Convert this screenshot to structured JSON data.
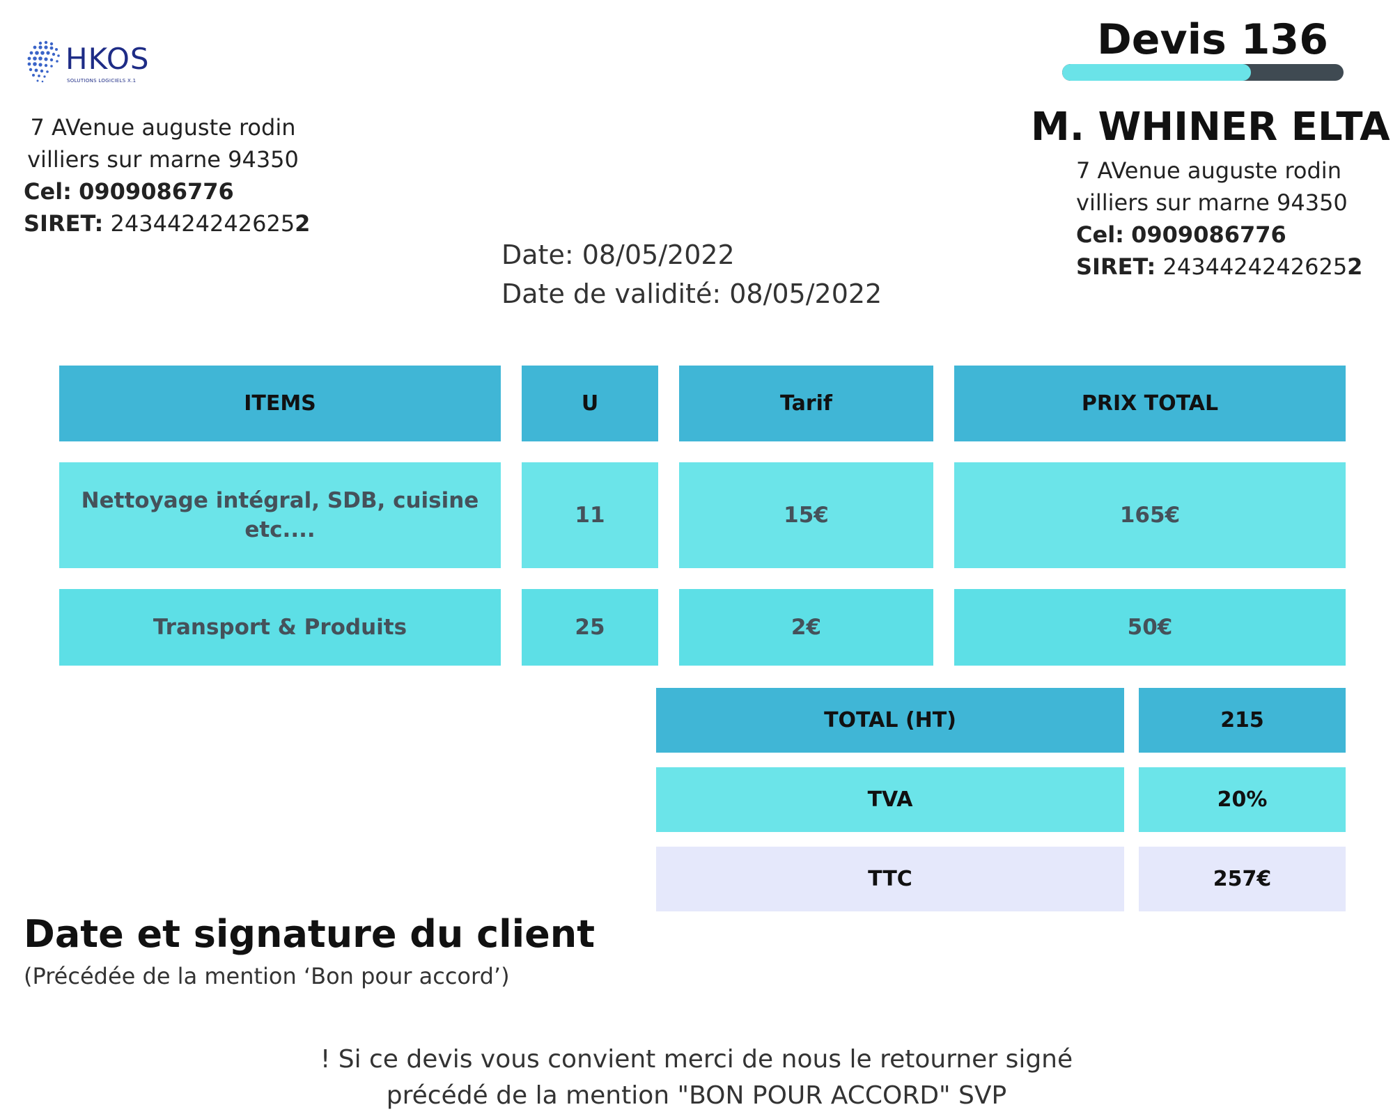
{
  "logo": {
    "brand": "HKOS",
    "tagline": "SOLUTIONS LOGICIELS X.1",
    "color": "#1e2c86"
  },
  "sender": {
    "street": "7 AVenue auguste rodin",
    "city": "villiers sur marne 94350",
    "cel_label": "Cel:",
    "cel_value": "0909086776",
    "siret_label": "SIRET:",
    "siret_value": "2434424242625",
    "siret_last": "2"
  },
  "quote": {
    "title": "Devis 136",
    "progress_fraction": 0.67
  },
  "client": {
    "name": "M. WHINER ELTA",
    "street": "7 AVenue auguste rodin",
    "city": "villiers sur marne 94350",
    "cel_label": "Cel:",
    "cel_value": "0909086776",
    "siret_label": "SIRET:",
    "siret_value": "2434424242625",
    "siret_last": "2"
  },
  "dates": {
    "date": "Date: 08/05/2022",
    "validity": "Date de validité: 08/05/2022"
  },
  "table": {
    "headers": [
      "ITEMS",
      "U",
      "Tarif",
      "PRIX TOTAL"
    ],
    "rows": [
      [
        "Nettoyage intégral, SDB, cuisine etc....",
        "11",
        "15€",
        "165€"
      ],
      [
        "Transport & Produits",
        "25",
        "2€",
        "50€"
      ]
    ]
  },
  "totals": {
    "ht_label": "TOTAL (HT)",
    "ht_value": "215",
    "tva_label": "TVA",
    "tva_value": "20%",
    "ttc_label": "TTC",
    "ttc_value": "257€"
  },
  "signature": {
    "title": "Date et signature du client",
    "subtitle": "(Précédée de la mention ‘Bon pour accord’)"
  },
  "footer": {
    "line1": "! Si ce devis vous convient merci de nous le retourner signé",
    "line2": "précédé de la mention \"BON POUR ACCORD\" SVP"
  },
  "colors": {
    "header_cell": "#40b6d6",
    "row_cell": "#6be4e9",
    "ttc_cell": "#e5e8fb",
    "progress_track": "#3f4a52",
    "progress_fill": "#6ae3e8"
  }
}
